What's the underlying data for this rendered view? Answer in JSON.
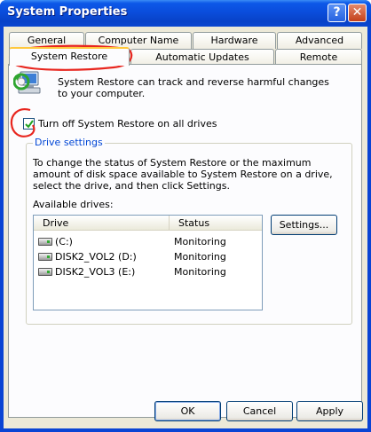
{
  "window": {
    "title": "System Properties",
    "help_glyph": "?",
    "close_glyph": "✕"
  },
  "tabs": {
    "row1": [
      {
        "label": "General"
      },
      {
        "label": "Computer Name"
      },
      {
        "label": "Hardware"
      },
      {
        "label": "Advanced"
      }
    ],
    "row2": [
      {
        "label": "System Restore",
        "active": true
      },
      {
        "label": "Automatic Updates"
      },
      {
        "label": "Remote"
      }
    ]
  },
  "intro": {
    "icon": "system-restore-icon",
    "text": "System Restore can track and reverse harmful changes to your computer."
  },
  "turn_off": {
    "label": "Turn off System Restore on all drives",
    "checked": true
  },
  "drive_settings": {
    "title": "Drive settings",
    "description": "To change the status of System Restore or the maximum amount of disk space available to System Restore on a drive, select the drive, and then click Settings.",
    "available_label": "Available drives:",
    "settings_button": "Settings...",
    "columns": {
      "drive": "Drive",
      "status": "Status"
    },
    "drives": [
      {
        "name": "(C:)",
        "status": "Monitoring"
      },
      {
        "name": "DISK2_VOL2 (D:)",
        "status": "Monitoring"
      },
      {
        "name": "DISK2_VOL3 (E:)",
        "status": "Monitoring"
      }
    ]
  },
  "buttons": {
    "ok": "OK",
    "cancel": "Cancel",
    "apply": "Apply"
  },
  "colors": {
    "title_bar": "#0a4ddc",
    "annotation": "#e8261f",
    "group_title": "#0046d5"
  }
}
